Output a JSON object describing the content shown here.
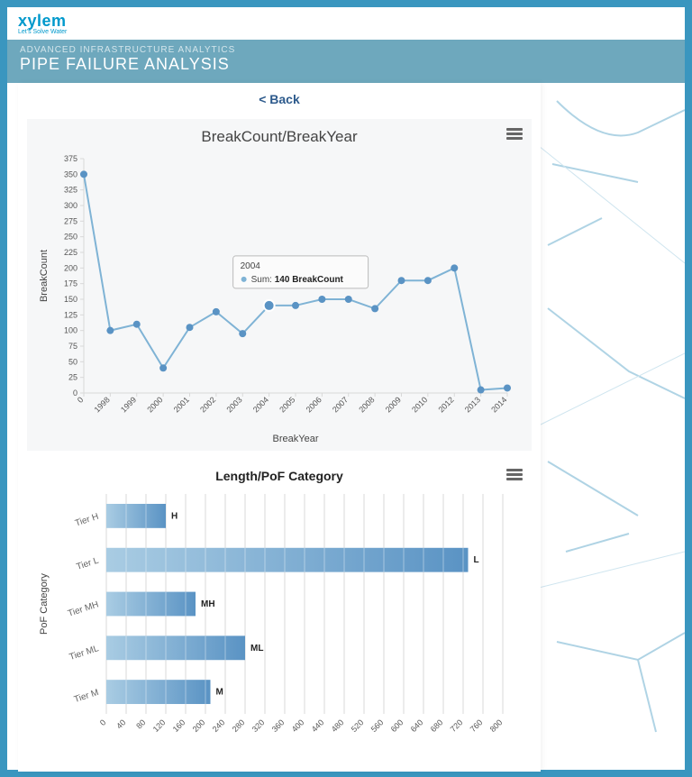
{
  "brand": {
    "name": "xylem",
    "tagline": "Let's Solve Water"
  },
  "header": {
    "sup": "ADVANCED INFRASTRUCTURE ANALYTICS",
    "title": "PIPE FAILURE ANALYSIS"
  },
  "back_label": "< Back",
  "tooltip": {
    "year": "2004",
    "prefix": "Sum:",
    "value": "140",
    "suffix": "BreakCount"
  },
  "chart1": {
    "title": "BreakCount/BreakYear",
    "xlabel": "BreakYear",
    "ylabel": "BreakCount"
  },
  "chart2": {
    "title": "Length/PoF Category",
    "ylabel": "PoF Category"
  },
  "chart_data": [
    {
      "type": "line",
      "title": "BreakCount/BreakYear",
      "xlabel": "BreakYear",
      "ylabel": "BreakCount",
      "ylim": [
        0,
        375
      ],
      "y_ticks": [
        0,
        25,
        50,
        75,
        100,
        125,
        150,
        175,
        200,
        225,
        250,
        275,
        300,
        325,
        350,
        375
      ],
      "categories": [
        "0",
        "1998",
        "1999",
        "2000",
        "2001",
        "2002",
        "2003",
        "2004",
        "2005",
        "2006",
        "2007",
        "2008",
        "2009",
        "2010",
        "2012",
        "2013",
        "2014"
      ],
      "values": [
        350,
        100,
        110,
        40,
        105,
        130,
        95,
        140,
        140,
        150,
        150,
        135,
        180,
        180,
        200,
        5,
        8
      ],
      "highlight": {
        "category": "2004",
        "value": 140,
        "label": "Sum: 140 BreakCount"
      }
    },
    {
      "type": "bar",
      "orientation": "horizontal",
      "title": "Length/PoF Category",
      "ylabel": "PoF Category",
      "xlim": [
        0,
        800
      ],
      "x_ticks": [
        0,
        40,
        80,
        120,
        160,
        200,
        240,
        280,
        320,
        360,
        400,
        440,
        480,
        520,
        560,
        600,
        640,
        680,
        720,
        760,
        800
      ],
      "categories": [
        "Tier H",
        "Tier L",
        "Tier MH",
        "Tier ML",
        "Tier M"
      ],
      "short": [
        "H",
        "L",
        "MH",
        "ML",
        "M"
      ],
      "values": [
        120,
        730,
        180,
        280,
        210
      ]
    }
  ]
}
